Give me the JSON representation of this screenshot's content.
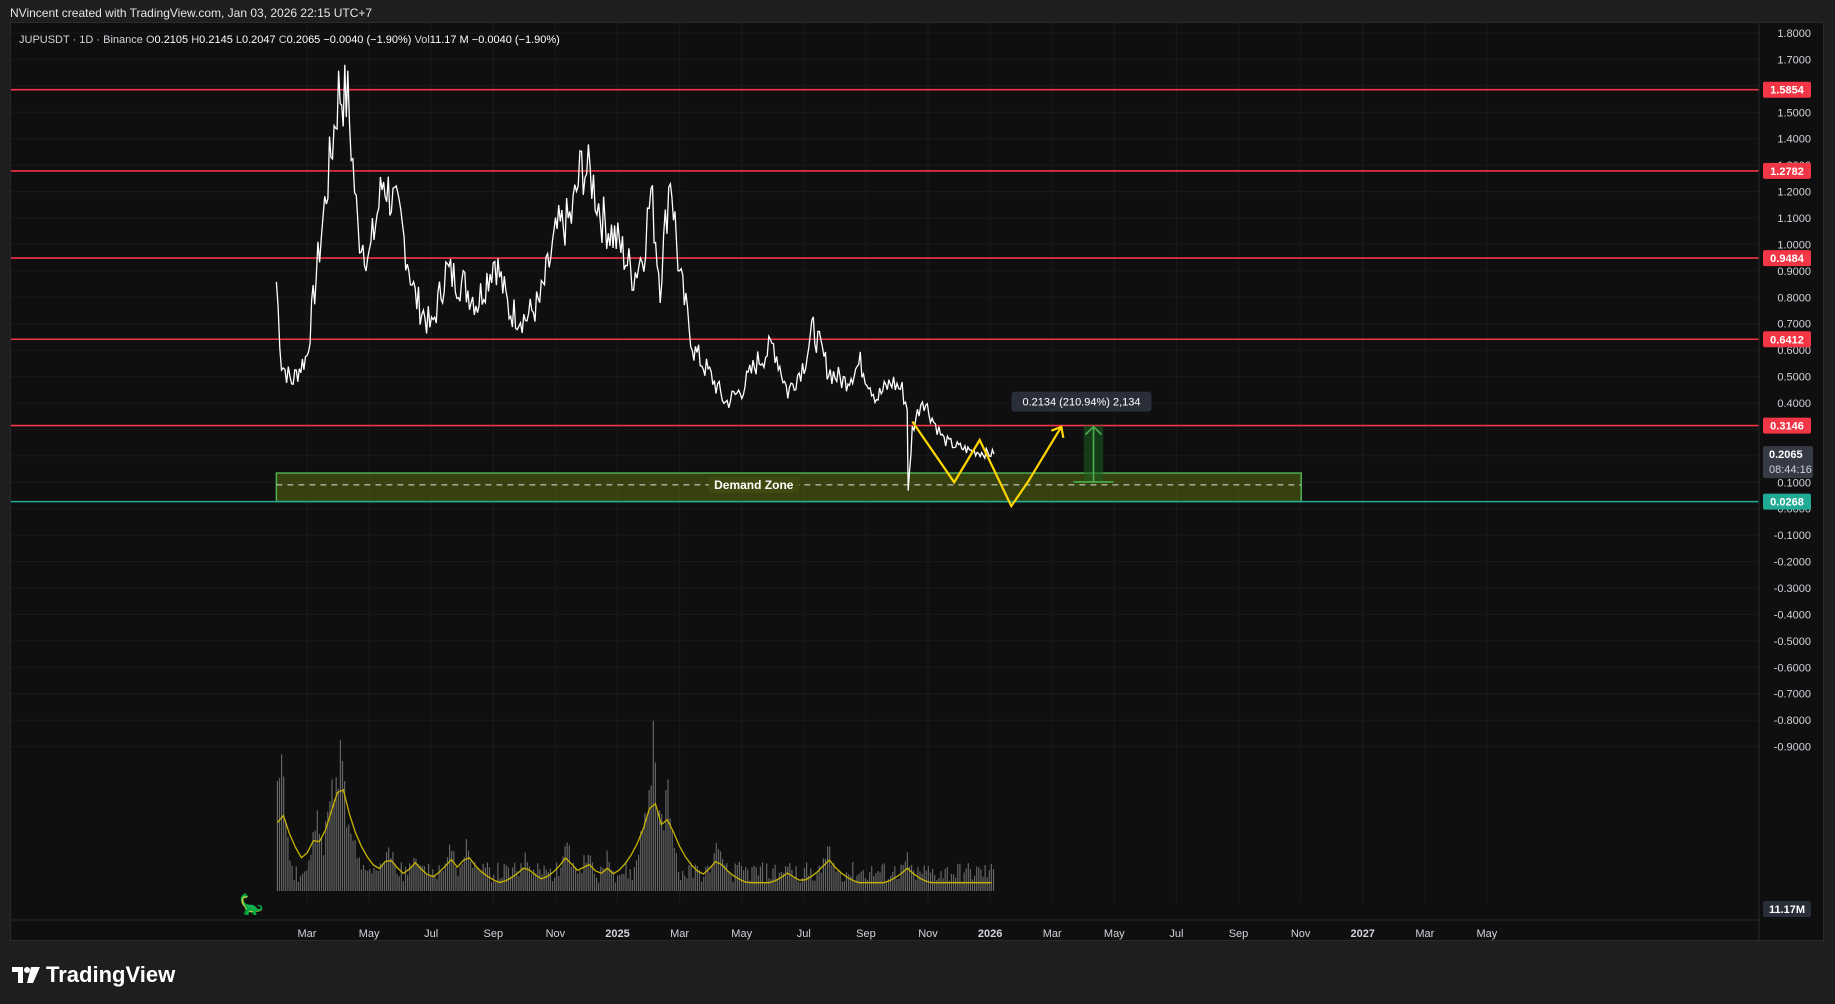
{
  "header": {
    "attribution": "NVincent created with TradingView.com, Jan 03, 2026 22:15 UTC+7"
  },
  "legend": {
    "symbol": "JUPUSDT · 1D · Binance",
    "o_label": "O",
    "o_value": "0.2105",
    "h_label": "H",
    "h_value": "0.2145",
    "l_label": "L",
    "l_value": "0.2047",
    "c_label": "C",
    "c_value": "0.2065",
    "change": "−0.0040 (−1.90%)",
    "vol_label": "Vol",
    "vol_value": "11.17 M",
    "vol_change": "−0.0040 (−1.90%)"
  },
  "footer": {
    "brand": "TradingView"
  },
  "chart_data": {
    "type": "line",
    "symbol": "JUPUSDT",
    "timeframe": "1D",
    "exchange": "Binance",
    "ylim": [
      -1.0,
      1.8
    ],
    "y_ticks": [
      "1.8000",
      "1.7000",
      "1.6000",
      "1.5000",
      "1.4000",
      "1.3000",
      "1.2000",
      "1.1000",
      "1.0000",
      "0.9000",
      "0.8000",
      "0.7000",
      "0.6000",
      "0.5000",
      "0.4000",
      "0.3000",
      "0.2000",
      "0.1000",
      "0.0000",
      "-0.1000",
      "-0.2000",
      "-0.3000",
      "-0.4000",
      "-0.5000",
      "-0.6000",
      "-0.7000",
      "-0.8000",
      "-0.9000"
    ],
    "x_ticks": [
      "Mar",
      "May",
      "Jul",
      "Sep",
      "Nov",
      "2025",
      "Mar",
      "May",
      "Jul",
      "Sep",
      "Nov",
      "2026",
      "Mar",
      "May",
      "Jul",
      "Sep",
      "Nov",
      "2027",
      "Mar",
      "May"
    ],
    "series": [
      {
        "x": [
          "2024-01-31",
          "2024-02-05",
          "2024-02-15",
          "2024-03-01",
          "2024-03-10",
          "2024-03-20",
          "2024-04-01",
          "2024-04-10",
          "2024-04-20",
          "2024-05-01",
          "2024-05-15",
          "2024-06-01",
          "2024-06-15",
          "2024-07-01",
          "2024-07-15",
          "2024-08-01",
          "2024-08-15",
          "2024-09-01",
          "2024-09-15",
          "2024-10-01",
          "2024-10-15",
          "2024-11-01",
          "2024-11-15",
          "2024-11-25",
          "2024-12-05",
          "2024-12-15",
          "2025-01-01",
          "2025-01-15",
          "2025-01-25",
          "2025-02-01",
          "2025-02-10",
          "2025-02-20",
          "2025-03-01",
          "2025-03-15",
          "2025-04-01",
          "2025-04-15",
          "2025-05-01",
          "2025-05-15",
          "2025-06-01",
          "2025-06-15",
          "2025-07-01",
          "2025-07-10",
          "2025-07-25",
          "2025-08-10",
          "2025-08-25",
          "2025-09-10",
          "2025-09-25",
          "2025-10-05",
          "2025-10-10",
          "2025-10-11",
          "2025-10-15",
          "2025-10-25",
          "2025-11-05",
          "2025-11-15",
          "2025-11-25",
          "2025-12-10",
          "2025-12-25",
          "2026-01-03"
        ],
        "values": [
          0.86,
          0.55,
          0.48,
          0.58,
          0.88,
          1.2,
          1.58,
          1.55,
          1.05,
          0.95,
          1.25,
          1.08,
          0.8,
          0.68,
          0.9,
          0.85,
          0.78,
          0.95,
          0.75,
          0.72,
          0.78,
          1.05,
          1.1,
          1.3,
          1.25,
          1.1,
          1.0,
          0.88,
          0.98,
          1.2,
          0.85,
          1.28,
          0.88,
          0.6,
          0.5,
          0.4,
          0.45,
          0.55,
          0.62,
          0.44,
          0.55,
          0.68,
          0.52,
          0.48,
          0.55,
          0.42,
          0.48,
          0.45,
          0.38,
          0.06,
          0.3,
          0.42,
          0.33,
          0.26,
          0.24,
          0.22,
          0.21,
          0.2065
        ]
      }
    ],
    "horizontal_levels": [
      1.5854,
      1.2782,
      0.9484,
      0.6412,
      0.3146,
      0.0268
    ],
    "demand_zone": {
      "label": "Demand Zone",
      "from": "2024-01-31",
      "to": "2026-10-31",
      "low": 0.0268,
      "high": 0.135,
      "mid": 0.09
    },
    "projection_path": {
      "x": [
        "2025-10-15",
        "2025-11-25",
        "2025-12-20",
        "2026-01-20",
        "2026-02-05",
        "2026-03-10"
      ],
      "values": [
        0.33,
        0.1,
        0.26,
        0.01,
        0.1,
        0.31
      ]
    },
    "measure": {
      "label": "0.2134 (210.94%) 2,134",
      "from_value": 0.1012,
      "to_value": 0.3146,
      "x_from": "2026-04-01",
      "x_to": "2026-04-20"
    },
    "price_tags": [
      {
        "value": "1.5854",
        "color": "#f23645"
      },
      {
        "value": "1.2782",
        "color": "#f23645"
      },
      {
        "value": "0.9484",
        "color": "#f23645"
      },
      {
        "value": "0.6412",
        "color": "#f23645"
      },
      {
        "value": "0.3146",
        "color": "#f23645"
      },
      {
        "value": "0.0268",
        "color": "#22ab94"
      }
    ],
    "last_price": {
      "value": "0.2065",
      "countdown": "08:44:16"
    },
    "volume": {
      "last_label": "11.17M",
      "spikes": [
        {
          "x": "2024-02-01",
          "h": 0.55
        },
        {
          "x": "2024-02-05",
          "h": 0.72
        },
        {
          "x": "2024-03-10",
          "h": 0.5
        },
        {
          "x": "2024-03-25",
          "h": 0.7
        },
        {
          "x": "2024-04-03",
          "h": 1.0
        },
        {
          "x": "2024-04-15",
          "h": 0.38
        },
        {
          "x": "2024-05-20",
          "h": 0.3
        },
        {
          "x": "2024-06-15",
          "h": 0.25
        },
        {
          "x": "2024-07-20",
          "h": 0.28
        },
        {
          "x": "2024-08-05",
          "h": 0.32
        },
        {
          "x": "2024-10-01",
          "h": 0.22
        },
        {
          "x": "2024-11-10",
          "h": 0.3
        },
        {
          "x": "2024-12-01",
          "h": 0.25
        },
        {
          "x": "2024-12-20",
          "h": 0.2
        },
        {
          "x": "2025-01-25",
          "h": 0.48
        },
        {
          "x": "2025-02-03",
          "h": 0.85
        },
        {
          "x": "2025-02-10",
          "h": 0.43
        },
        {
          "x": "2025-02-18",
          "h": 0.65
        },
        {
          "x": "2025-04-07",
          "h": 0.28
        },
        {
          "x": "2025-06-15",
          "h": 0.16
        },
        {
          "x": "2025-07-25",
          "h": 0.28
        },
        {
          "x": "2025-10-10",
          "h": 0.2
        }
      ],
      "ma_color": "#c8b400"
    },
    "colors": {
      "price_line": "#ffffff",
      "level_line": "#f23645",
      "support_line": "#22ab94",
      "zone_fill": "#5a6a10",
      "projection": "#ffd600",
      "measure": "#4caf50"
    }
  }
}
